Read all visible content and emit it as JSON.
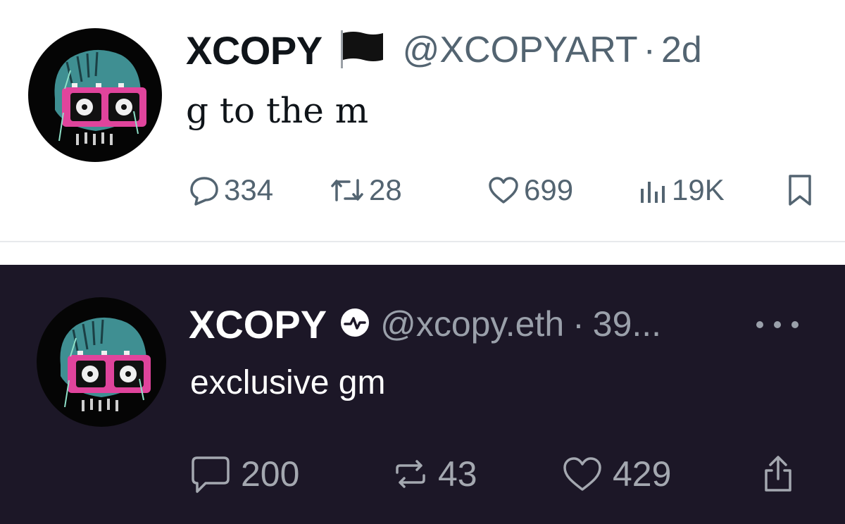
{
  "post_light": {
    "display_name": "XCOPY",
    "flag_icon": "black-flag-icon",
    "handle": "@XCOPYART",
    "separator": "·",
    "time": "2d",
    "text": "g to the m",
    "actions": {
      "replies": "334",
      "reposts": "28",
      "likes": "699",
      "views": "19K"
    }
  },
  "post_dark": {
    "display_name": "XCOPY",
    "badge_icon": "verified-pulse-badge-icon",
    "handle": "@xcopy.eth",
    "separator": "·",
    "time": "39...",
    "text": "exclusive gm",
    "actions": {
      "replies": "200",
      "reposts": "43",
      "likes": "429"
    }
  },
  "colors": {
    "light_bg": "#ffffff",
    "dark_bg": "#1c1727",
    "muted_light": "#536471",
    "muted_dark": "#9aa0aa",
    "avatar_pink": "#e0449c",
    "avatar_teal": "#3f8f92"
  }
}
